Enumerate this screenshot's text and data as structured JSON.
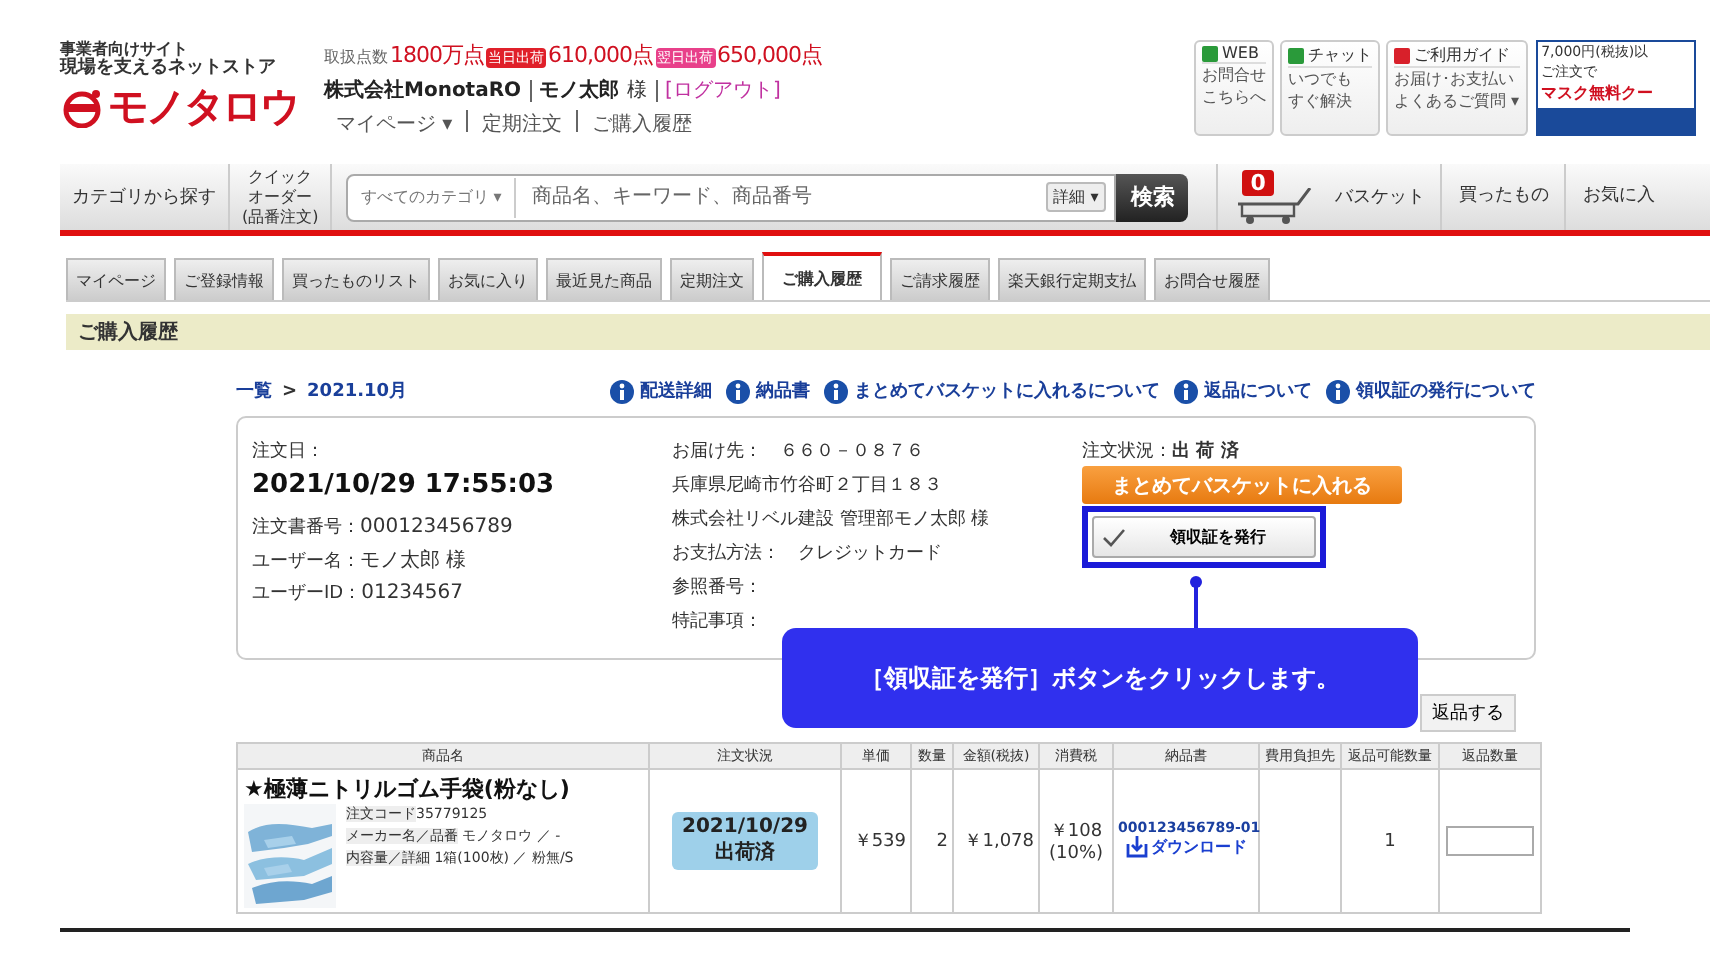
{
  "header": {
    "tagline": [
      "事業者向けサイト",
      "現場を支えるネットストア"
    ],
    "logo": "モノタロウ",
    "stats": [
      {
        "kind": "label",
        "text": "取扱点数"
      },
      {
        "kind": "value",
        "text": "1800万点"
      },
      {
        "kind": "badge",
        "text": "当日出荷",
        "color": "#e0202a"
      },
      {
        "kind": "value",
        "text": "610,000点"
      },
      {
        "kind": "badge",
        "text": "翌日出荷",
        "color": "#e8408a"
      },
      {
        "kind": "value",
        "text": "650,000点"
      }
    ],
    "company": "株式会社MonotaRO",
    "user": "モノ太郎",
    "honorific": "様",
    "logout": "[ログアウト]",
    "links": [
      "マイページ ▾",
      "定期注文",
      "ご購入履歴"
    ],
    "help": [
      {
        "title": "WEB",
        "lines": [
          "お問合せ",
          "こちらへ"
        ],
        "color": "#2a9a3a"
      },
      {
        "title": "チャット",
        "lines": [
          "いつでも",
          "すぐ解決"
        ],
        "color": "#2a9a3a"
      },
      {
        "title": "ご利用ガイド",
        "lines": [
          "お届け･お支払い",
          "よくあるご質問 ▾"
        ],
        "color": "#d8202a"
      }
    ],
    "promo": [
      "7,000円(税抜)以",
      "ご注文で",
      "マスク無料クー"
    ]
  },
  "nav": {
    "category": "カテゴリから探す",
    "quick": [
      "クイック",
      "オーダー",
      "(品番注文)"
    ],
    "search_category": "すべてのカテゴリ ▾",
    "search": {
      "placeholder": "商品名、キーワード、商品番号"
    },
    "detail": "詳細 ▾",
    "search_button": "検索",
    "basket_count": "0",
    "basket": "バスケット",
    "bought": "買ったもの",
    "favorites": "お気に入"
  },
  "tabs": [
    {
      "label": "マイページ",
      "selected": false
    },
    {
      "label": "ご登録情報",
      "selected": false
    },
    {
      "label": "買ったものリスト",
      "selected": false
    },
    {
      "label": "お気に入り",
      "selected": false
    },
    {
      "label": "最近見た商品",
      "selected": false
    },
    {
      "label": "定期注文",
      "selected": false
    },
    {
      "label": "ご購入履歴",
      "selected": true
    },
    {
      "label": "ご請求履歴",
      "selected": false
    },
    {
      "label": "楽天銀行定期支払",
      "selected": false
    },
    {
      "label": "お問合せ履歴",
      "selected": false
    }
  ],
  "section_title": "ご購入履歴",
  "breadcrumb": [
    "一覧",
    ">",
    "2021.10月"
  ],
  "info_links": [
    "配送詳細",
    "納品書",
    "まとめてバスケットに入れるについて",
    "返品について",
    "領収証の発行について"
  ],
  "order": {
    "date_label": "注文日：",
    "date": "2021/10/29 17:55:03",
    "left": [
      {
        "label": "注文書番号：",
        "value": "000123456789"
      },
      {
        "label": "ユーザー名：",
        "value": "モノ太郎 様"
      },
      {
        "label": "ユーザーID：",
        "value": "01234567"
      }
    ],
    "middle": [
      "お届け先：　６６０－０８７６",
      "兵庫県尼崎市竹谷町２丁目１８３",
      "株式会社リベル建設 管理部モノ太郎 様",
      "お支払方法：　クレジットカード",
      "参照番号：",
      "特記事項："
    ],
    "status_label": "注文状況：",
    "status": "出 荷 済",
    "basket_button": "まとめてバスケットに入れる",
    "receipt_button": "領収証を発行"
  },
  "callout": "［領収証を発行］ボタンをクリックします。",
  "return_button": "返品する",
  "table": {
    "columns": [
      "商品名",
      "注文状況",
      "単価",
      "数量",
      "金額(税抜)",
      "消費税",
      "納品書",
      "費用負担先",
      "返品可能数量",
      "返品数量"
    ],
    "rows": [
      {
        "name": "★極薄ニトリルゴム手袋(粉なし)",
        "details": [
          {
            "label": "注文コード",
            "value": "35779125"
          },
          {
            "label": "メーカー名／品番",
            "value": " モノタロウ ／ -"
          },
          {
            "label": "内容量／詳細",
            "value": " 1箱(100枚) ／ 粉無/S"
          }
        ],
        "status_date": "2021/10/29",
        "status": "出荷済",
        "price": "￥539",
        "qty": "2",
        "amount": "￥1,078",
        "tax": "￥108",
        "tax_rate": "(10%)",
        "invoice": "000123456789-01",
        "download": "ダウンロード",
        "returnable": "1"
      }
    ]
  }
}
